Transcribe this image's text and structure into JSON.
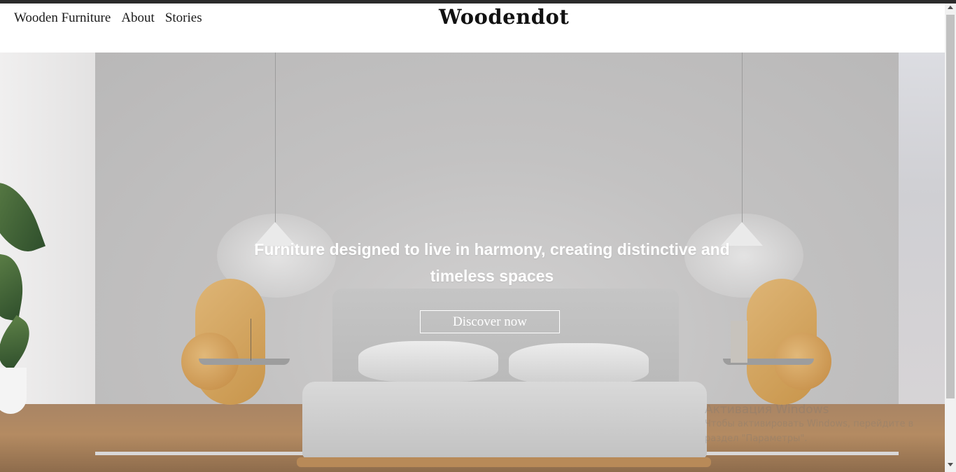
{
  "header": {
    "nav": [
      {
        "label": "Wooden Furniture"
      },
      {
        "label": "About"
      },
      {
        "label": "Stories"
      }
    ],
    "logo": "Woodendot"
  },
  "hero": {
    "headline": "Furniture designed to live in harmony, creating distinctive and timeless spaces",
    "cta_label": "Discover now"
  },
  "watermark": {
    "title": "Активация Windows",
    "line1": "Чтобы активировать Windows, перейдите в",
    "line2": "раздел \"Параметры\"."
  },
  "colors": {
    "text": "#1a1a1a",
    "hero_text": "#ffffff",
    "wood": "#c8954b"
  }
}
